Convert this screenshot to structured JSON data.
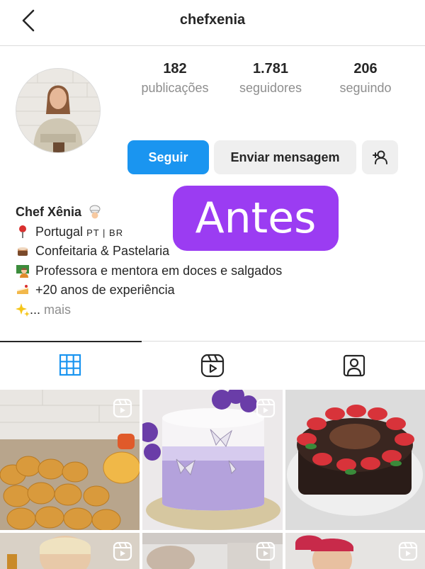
{
  "header": {
    "username": "chefxenia"
  },
  "profile": {
    "stats": [
      {
        "value": "182",
        "label": "publicações"
      },
      {
        "value": "1.781",
        "label": "seguidores"
      },
      {
        "value": "206",
        "label": "seguindo"
      }
    ],
    "buttons": {
      "follow": "Seguir",
      "message": "Enviar mensagem"
    },
    "bio": {
      "name": "Chef Xênia",
      "line1": "Portugal",
      "line1_flags": "PT | BR",
      "line2": "Confeitaria & Pastelaria",
      "line3": "Professora e mentora em doces e salgados",
      "line4": "+20 anos de experiência",
      "ellipsis": "...",
      "more": "mais"
    }
  },
  "overlay": {
    "label": "Antes"
  },
  "colors": {
    "accent": "#1a95f0",
    "overlay": "#9b3cf2",
    "tab_active": "#1a95f0",
    "muted": "#8e8e8e"
  },
  "tabs": [
    {
      "name": "posts-grid",
      "icon": "grid-icon",
      "active": true
    },
    {
      "name": "reels",
      "icon": "reels-icon",
      "active": false
    },
    {
      "name": "tagged",
      "icon": "tagged-person-icon",
      "active": false
    }
  ],
  "grid_items": [
    {
      "name": "coxinhas-reel",
      "icon": "reel-icon"
    },
    {
      "name": "butterfly-cake-reel",
      "icon": "reel-icon"
    },
    {
      "name": "strawberry-tart-post"
    },
    {
      "name": "chef-portrait-reel",
      "icon": "reel-icon"
    },
    {
      "name": "kitchen-reel",
      "icon": "reel-icon"
    },
    {
      "name": "chef-smile-reel",
      "icon": "reel-icon"
    }
  ]
}
